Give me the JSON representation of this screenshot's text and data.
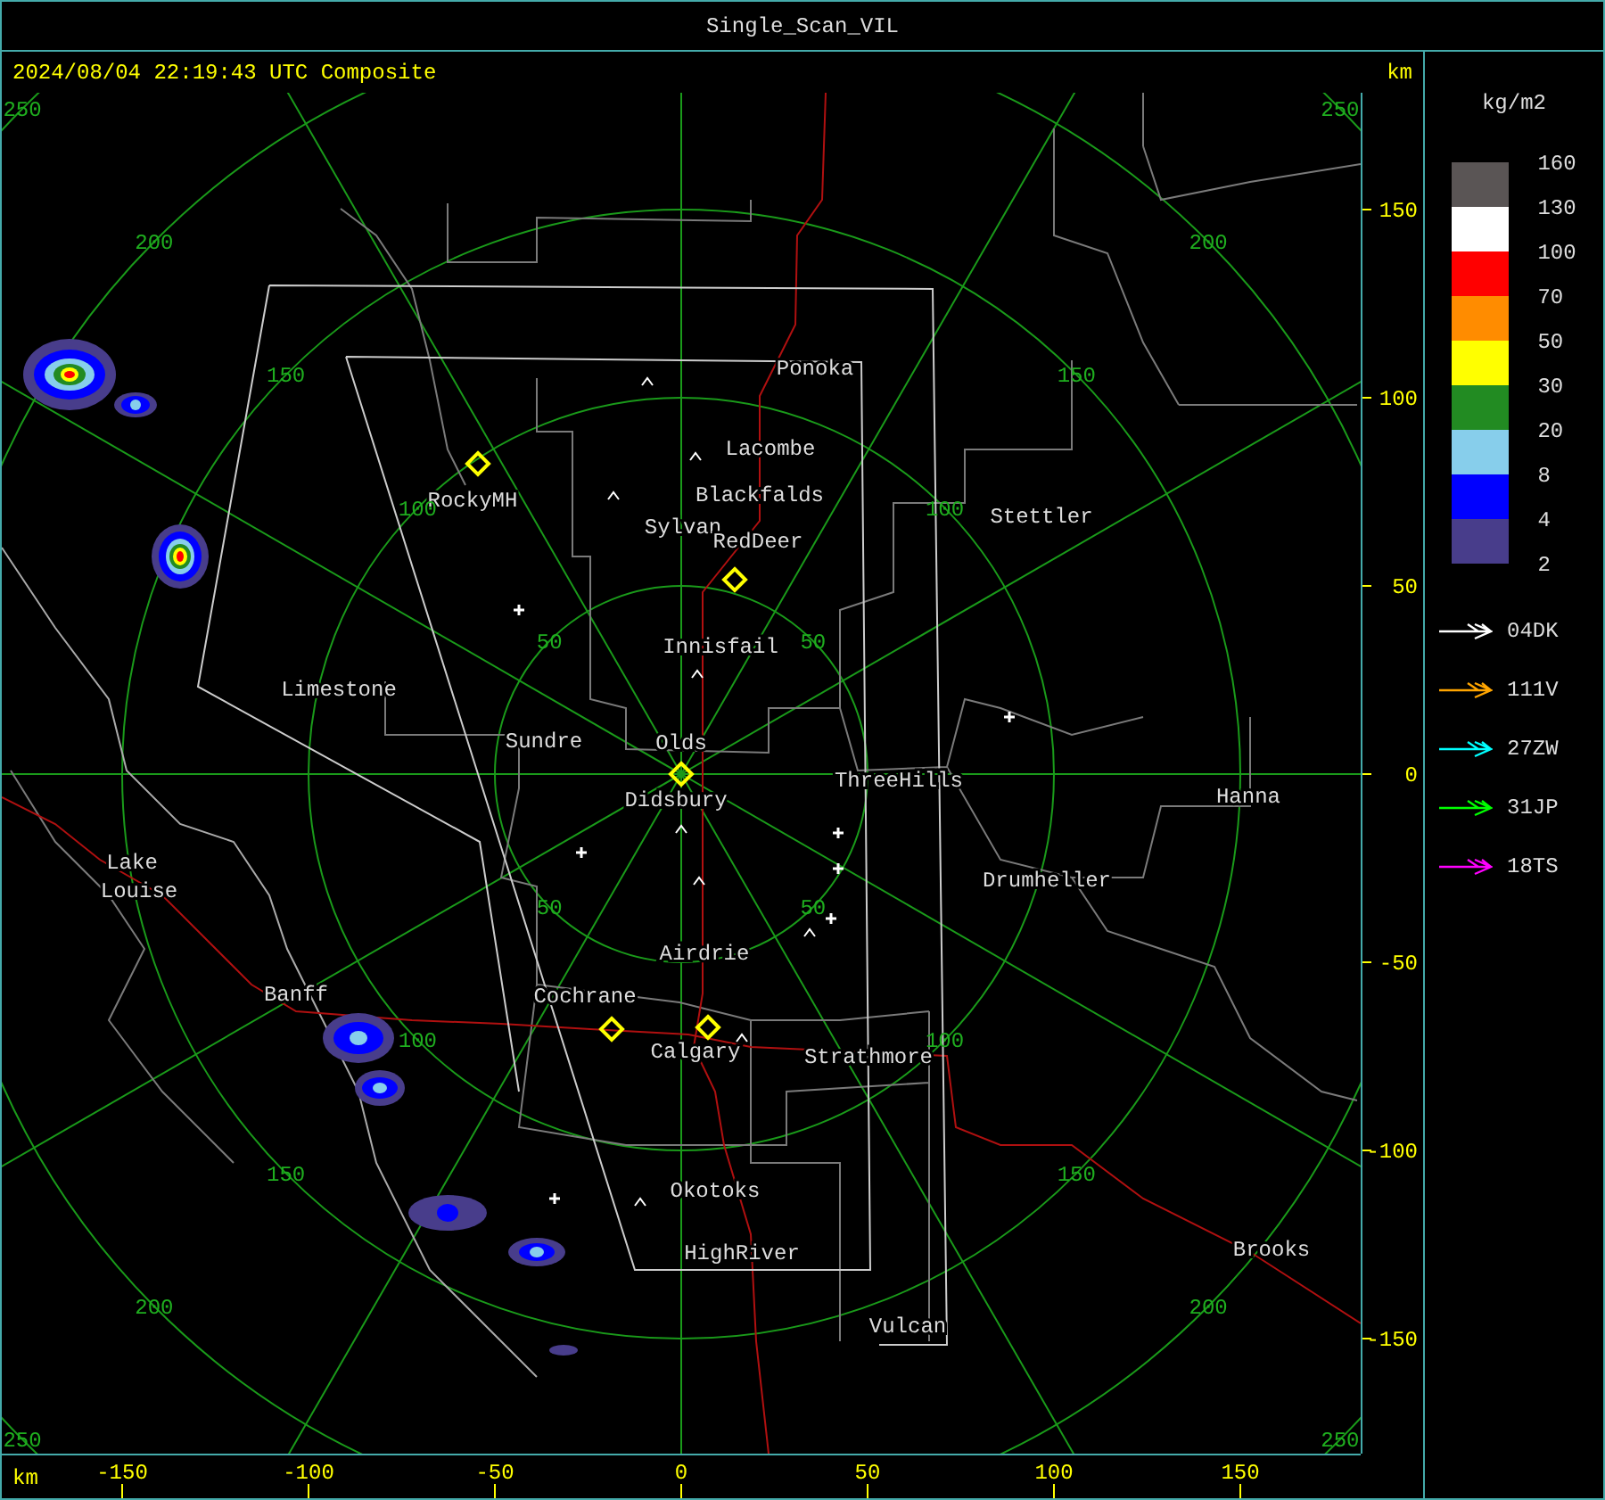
{
  "window": {
    "title": "Single_Scan_VIL"
  },
  "header": {
    "timestamp": "2024/08/04 22:19:43 UTC Composite",
    "unit": "km"
  },
  "cities": [
    {
      "name": "Ponoka"
    },
    {
      "name": "Lacombe"
    },
    {
      "name": "Blackfalds"
    },
    {
      "name": "Sylvan"
    },
    {
      "name": "RedDeer"
    },
    {
      "name": "RockyMH"
    },
    {
      "name": "Stettler"
    },
    {
      "name": "Innisfail"
    },
    {
      "name": "Limestone"
    },
    {
      "name": "Sundre"
    },
    {
      "name": "Olds"
    },
    {
      "name": "Didsbury"
    },
    {
      "name": "ThreeHills"
    },
    {
      "name": "Hanna"
    },
    {
      "name": "Drumheller"
    },
    {
      "name": "Lake"
    },
    {
      "name": "Louise"
    },
    {
      "name": "Airdrie"
    },
    {
      "name": "Banff"
    },
    {
      "name": "Cochrane"
    },
    {
      "name": "Calgary"
    },
    {
      "name": "Strathmore"
    },
    {
      "name": "Okotoks"
    },
    {
      "name": "HighRiver"
    },
    {
      "name": "Brooks"
    },
    {
      "name": "Vulcan"
    }
  ],
  "range_rings": [
    {
      "labels": [
        "50",
        "50",
        "50",
        "50"
      ]
    },
    {
      "labels": [
        "100",
        "100",
        "100",
        "100"
      ]
    },
    {
      "labels": [
        "150",
        "150",
        "150",
        "150"
      ]
    },
    {
      "labels": [
        "200",
        "200",
        "200",
        "200"
      ]
    },
    {
      "labels": [
        "250",
        "250",
        "250",
        "250"
      ]
    }
  ],
  "x_axis": {
    "unit": "km",
    "ticks": [
      "-150",
      "-100",
      "-50",
      "0",
      "50",
      "100",
      "150"
    ]
  },
  "y_axis": {
    "ticks": [
      "150",
      "100",
      "50",
      "0",
      "-50",
      "-100",
      "-150"
    ]
  },
  "legend": {
    "unit": "kg/m2",
    "bins": [
      {
        "color": "#5a5555"
      },
      {
        "color": "#ffffff"
      },
      {
        "color": "#ff0000"
      },
      {
        "color": "#ff8c00"
      },
      {
        "color": "#ffff00"
      },
      {
        "color": "#228b22"
      },
      {
        "color": "#87ceeb"
      },
      {
        "color": "#0000ff"
      },
      {
        "color": "#483d8b"
      }
    ],
    "labels": [
      "160",
      "130",
      "100",
      "70",
      "50",
      "30",
      "20",
      "8",
      "4",
      "2"
    ]
  },
  "tracks": [
    {
      "label": "04DK",
      "color": "#ffffff"
    },
    {
      "label": "111V",
      "color": "#ffa500"
    },
    {
      "label": "27ZW",
      "color": "#00ffff"
    },
    {
      "label": "31JP",
      "color": "#00ff00"
    },
    {
      "label": "18TS",
      "color": "#ff00ff"
    }
  ]
}
